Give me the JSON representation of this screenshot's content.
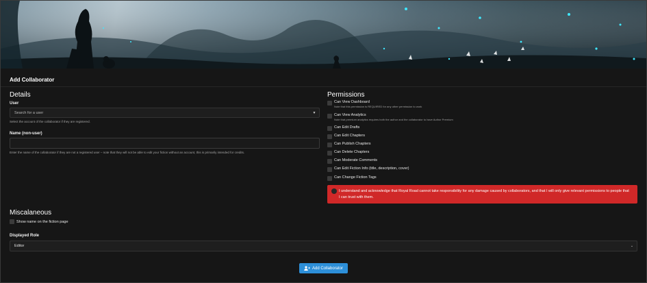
{
  "panel": {
    "title": "Add Collaborator"
  },
  "details": {
    "title": "Details",
    "user_label": "User",
    "user_placeholder": "Search for a user",
    "user_help": "Select the account of the collaborator if they are registered.",
    "name_label": "Name (non-user)",
    "name_value": "",
    "name_help": "Enter the name of the collaborator if they are not a registered user – note that they will not be able to edit your fiction without an account, this is primarily intended for credits."
  },
  "permissions": {
    "title": "Permissions",
    "items": [
      {
        "label": "Can View Dashboard",
        "note": "Note that this permission is REQUIRED for any other permission to work"
      },
      {
        "label": "Can View Analytics",
        "note": "Note that premium analytics requires both the author and the collaborator to have Author Premium"
      },
      {
        "label": "Can Edit Drafts",
        "note": ""
      },
      {
        "label": "Can Edit Chapters",
        "note": ""
      },
      {
        "label": "Can Publish Chapters",
        "note": ""
      },
      {
        "label": "Can Delete Chapters",
        "note": ""
      },
      {
        "label": "Can Moderate Comments",
        "note": ""
      },
      {
        "label": "Can Edit Fiction Info (title, description, cover)",
        "note": ""
      },
      {
        "label": "Can Change Fiction Tags",
        "note": ""
      }
    ],
    "acknowledge": "I understand and acknowledge that Royal Road cannot take responsibility for any damage caused by collaborators, and that I will only give relevant permissions to people that I can trust with them."
  },
  "misc": {
    "title": "Miscalaneous",
    "show_name_label": "Show name on the fiction page",
    "role_label": "Displayed Role",
    "role_value": "Editor"
  },
  "actions": {
    "submit_label": "Add Collaborator"
  },
  "colors": {
    "accent": "#2d8fd8",
    "danger": "#d02828",
    "background": "#161616"
  },
  "icons": {
    "select": "chevron-down-icon",
    "submit": "add-user-icon"
  }
}
